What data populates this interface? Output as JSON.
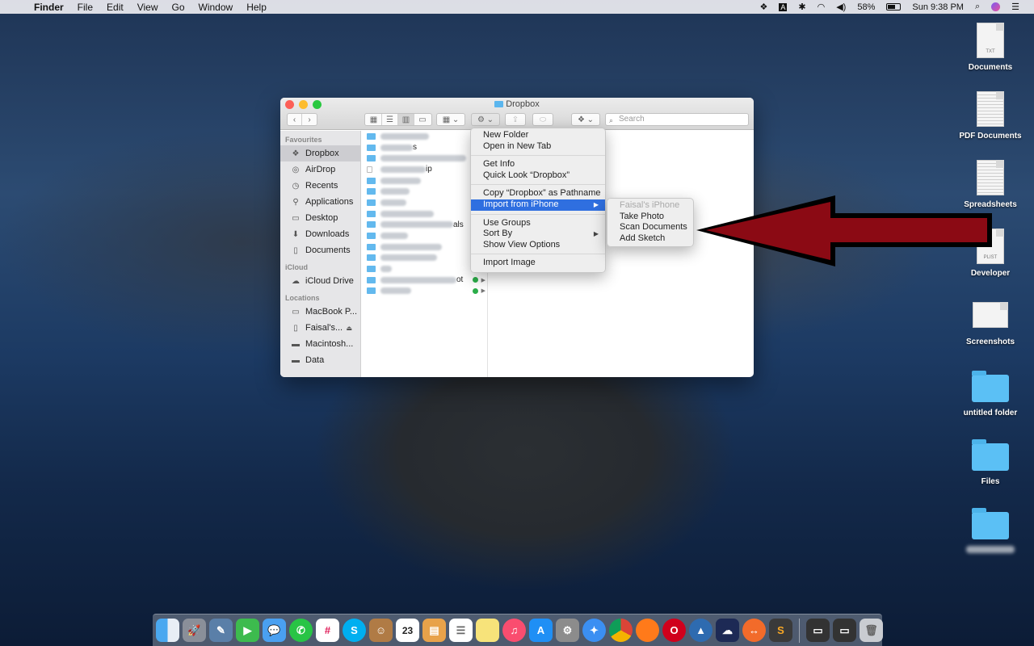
{
  "menubar": {
    "app": "Finder",
    "items": [
      "File",
      "Edit",
      "View",
      "Go",
      "Window",
      "Help"
    ],
    "battery": "58%",
    "clock": "Sun 9:38 PM"
  },
  "desktop": {
    "icons": [
      {
        "label": "Documents",
        "doc_tag": "TXT"
      },
      {
        "label": "PDF Documents",
        "doc_tag": ""
      },
      {
        "label": "Spreadsheets",
        "doc_tag": ""
      },
      {
        "label": "Developer",
        "doc_tag": "PLIST"
      },
      {
        "label": "Screenshots",
        "doc_tag": ""
      },
      {
        "label": "untitled folder",
        "doc_tag": ""
      },
      {
        "label": "Files",
        "doc_tag": ""
      },
      {
        "label": "",
        "doc_tag": ""
      }
    ]
  },
  "finder": {
    "title": "Dropbox",
    "search_placeholder": "Search",
    "sidebar": {
      "favourites_heading": "Favourites",
      "favourites": [
        "Dropbox",
        "AirDrop",
        "Recents",
        "Applications",
        "Desktop",
        "Downloads",
        "Documents"
      ],
      "icloud_heading": "iCloud",
      "icloud": [
        "iCloud Drive"
      ],
      "locations_heading": "Locations",
      "locations": [
        "MacBook P...",
        "Faisal's...",
        "Macintosh...",
        "Data"
      ]
    },
    "file_rows_visible_text": [
      "s",
      "ip",
      "als",
      "ot"
    ]
  },
  "context_menu": {
    "items": [
      "New Folder",
      "Open in New Tab",
      "Get Info",
      "Quick Look “Dropbox”",
      "Copy “Dropbox” as Pathname",
      "Import from iPhone",
      "Use Groups",
      "Sort By",
      "Show View Options",
      "Import Image"
    ],
    "highlighted": "Import from iPhone"
  },
  "submenu": {
    "items": [
      "Faisal's iPhone",
      "Take Photo",
      "Scan Documents",
      "Add Sketch"
    ]
  },
  "dock": {
    "calendar_day": "23"
  },
  "colors": {
    "highlight": "#2f6fe0",
    "arrow": "#8b0a14",
    "folder": "#5bc0f5"
  }
}
